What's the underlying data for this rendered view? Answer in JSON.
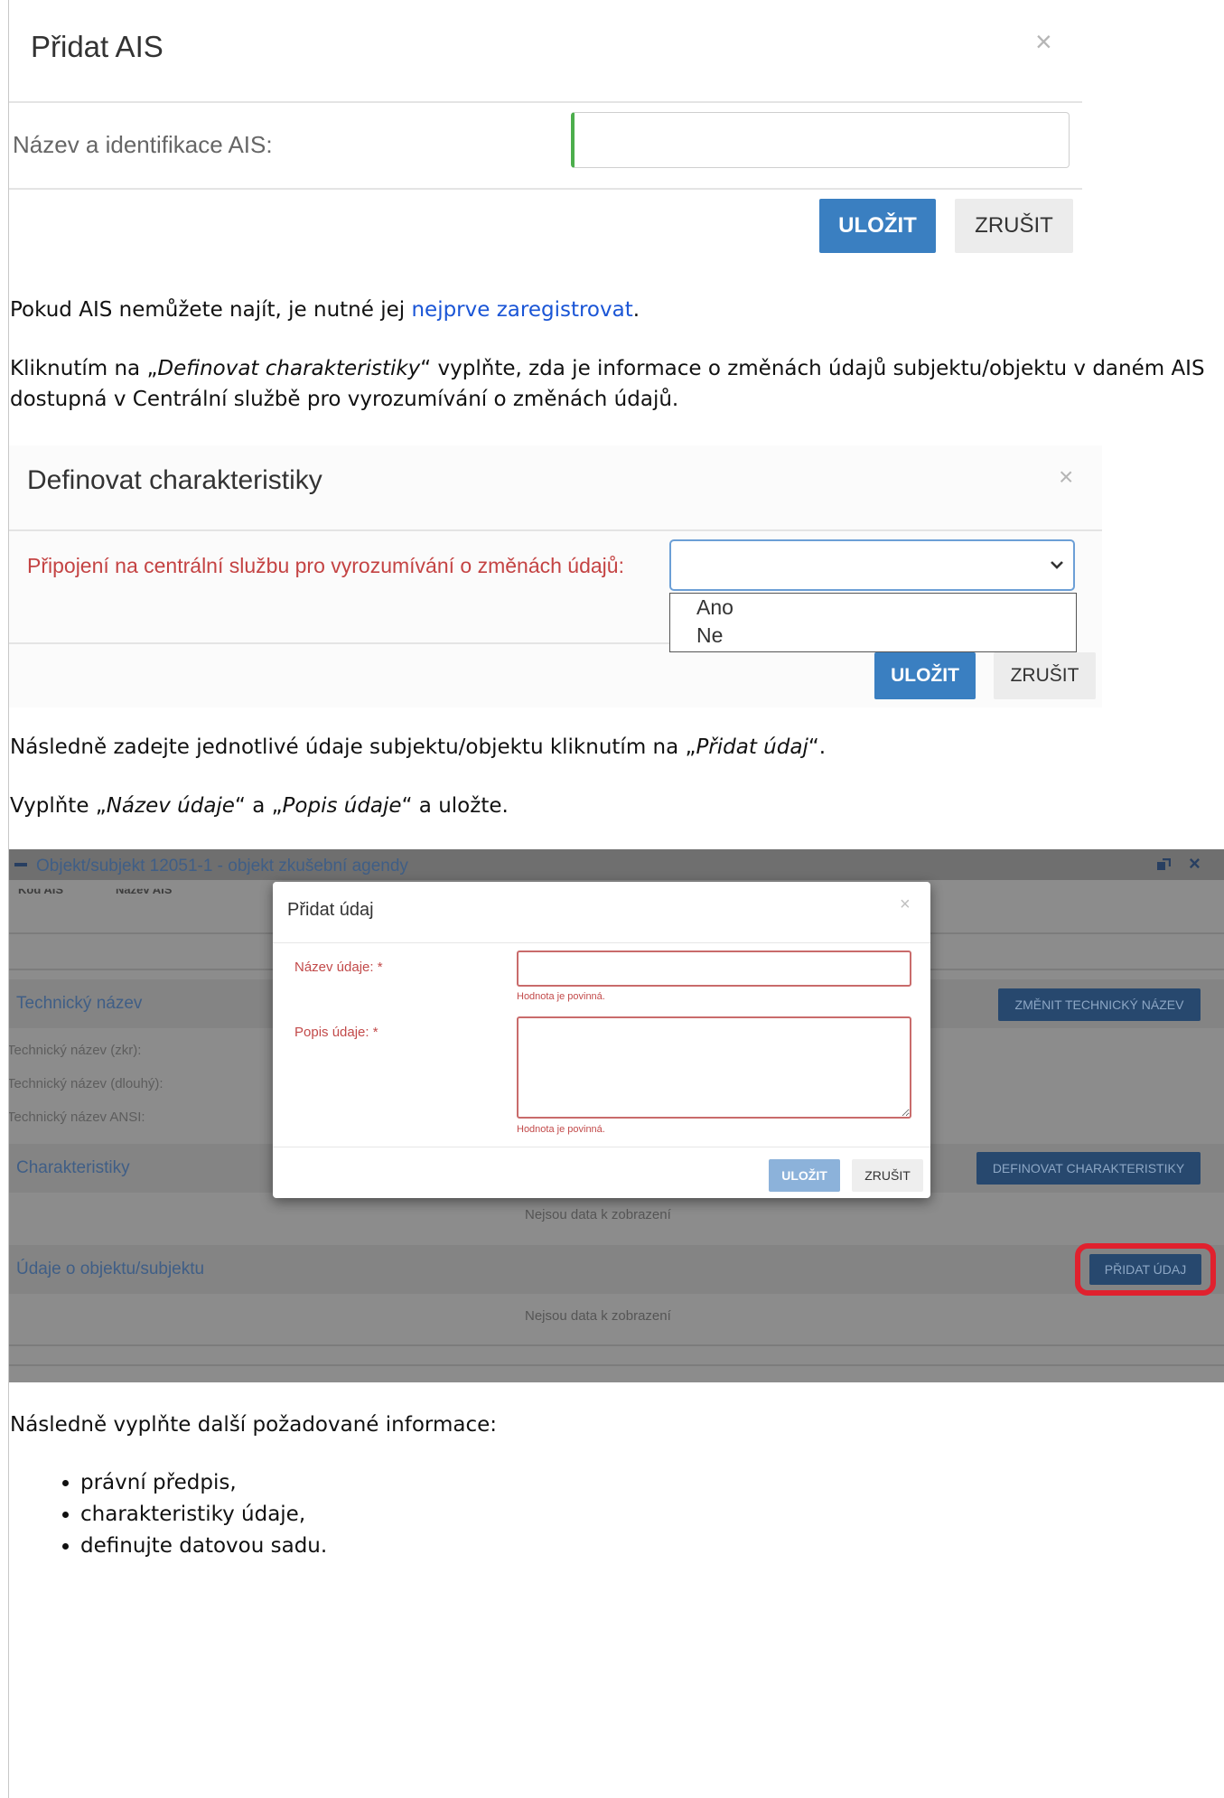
{
  "dialog_add_ais": {
    "title": "Přidat AIS",
    "close_glyph": "×",
    "field_label": "Název a identifikace AIS:",
    "field_value": "",
    "save_label": "ULOŽIT",
    "cancel_label": "ZRUŠIT"
  },
  "text": {
    "p1_before": "Pokud AIS nemůžete najít, je nutné jej ",
    "p1_link": "nejprve zaregistrovat",
    "p1_after": ".",
    "p2_before": "Kliknutím na „",
    "p2_em": "Definovat charakteristiky",
    "p2_after": "“ vyplňte, zda je informace o změnách údajů subjektu/objektu v daném AIS dostupná v Centrální službě pro vyrozumívání o změnách údajů.",
    "p3_before": "Následně zadejte jednotlivé údaje subjektu/objektu kliknutím na „",
    "p3_em": "Přidat údaj",
    "p3_after": "“.",
    "p4_before": "Vyplňte „",
    "p4_em1": "Název údaje",
    "p4_mid": "“ a „",
    "p4_em2": "Popis údaje",
    "p4_after": "“ a uložte.",
    "p5": "Následně vyplňte další požadované informace:",
    "list": [
      "právní předpis,",
      "charakteristiky údaje,",
      "definujte datovou sadu."
    ]
  },
  "dialog_characteristics": {
    "title": "Definovat charakteristiky",
    "close_glyph": "×",
    "field_label": "Připojení na centrální službu pro vyrozumívání o změnách údajů:",
    "select_value": "",
    "options": [
      "Ano",
      "Ne"
    ],
    "save_label": "ULOŽIT",
    "cancel_label": "ZRUŠIT"
  },
  "app": {
    "panel_title": "Objekt/subjekt 12051-1 - objekt zkušební agendy",
    "col_headers": [
      "Kód AIS",
      "Název AIS"
    ],
    "section_technical": "Technický název",
    "btn_change_technical": "ZMĚNIT TECHNICKÝ NÁZEV",
    "technical_rows": [
      "Technický název (zkr):",
      "Technický název (dlouhý):",
      "Technický název ANSI:"
    ],
    "section_characteristics": "Charakteristiky",
    "btn_define_characteristics": "DEFINOVAT CHARAKTERISTIKY",
    "no_data_1": "Nejsou data k zobrazení",
    "section_data": "Údaje o objektu/subjektu",
    "btn_add_data": "PŘIDAT ÚDAJ",
    "no_data_2": "Nejsou data k zobrazení",
    "highlight_color": "#e0212e"
  },
  "modal_add_data": {
    "title": "Přidat údaj",
    "close_glyph": "×",
    "name_label": "Název údaje: *",
    "name_value": "",
    "name_error": "Hodnota je povinná.",
    "desc_label": "Popis údaje: *",
    "desc_value": "",
    "desc_error": "Hodnota je povinná.",
    "save_label": "ULOŽIT",
    "cancel_label": "ZRUŠIT"
  }
}
